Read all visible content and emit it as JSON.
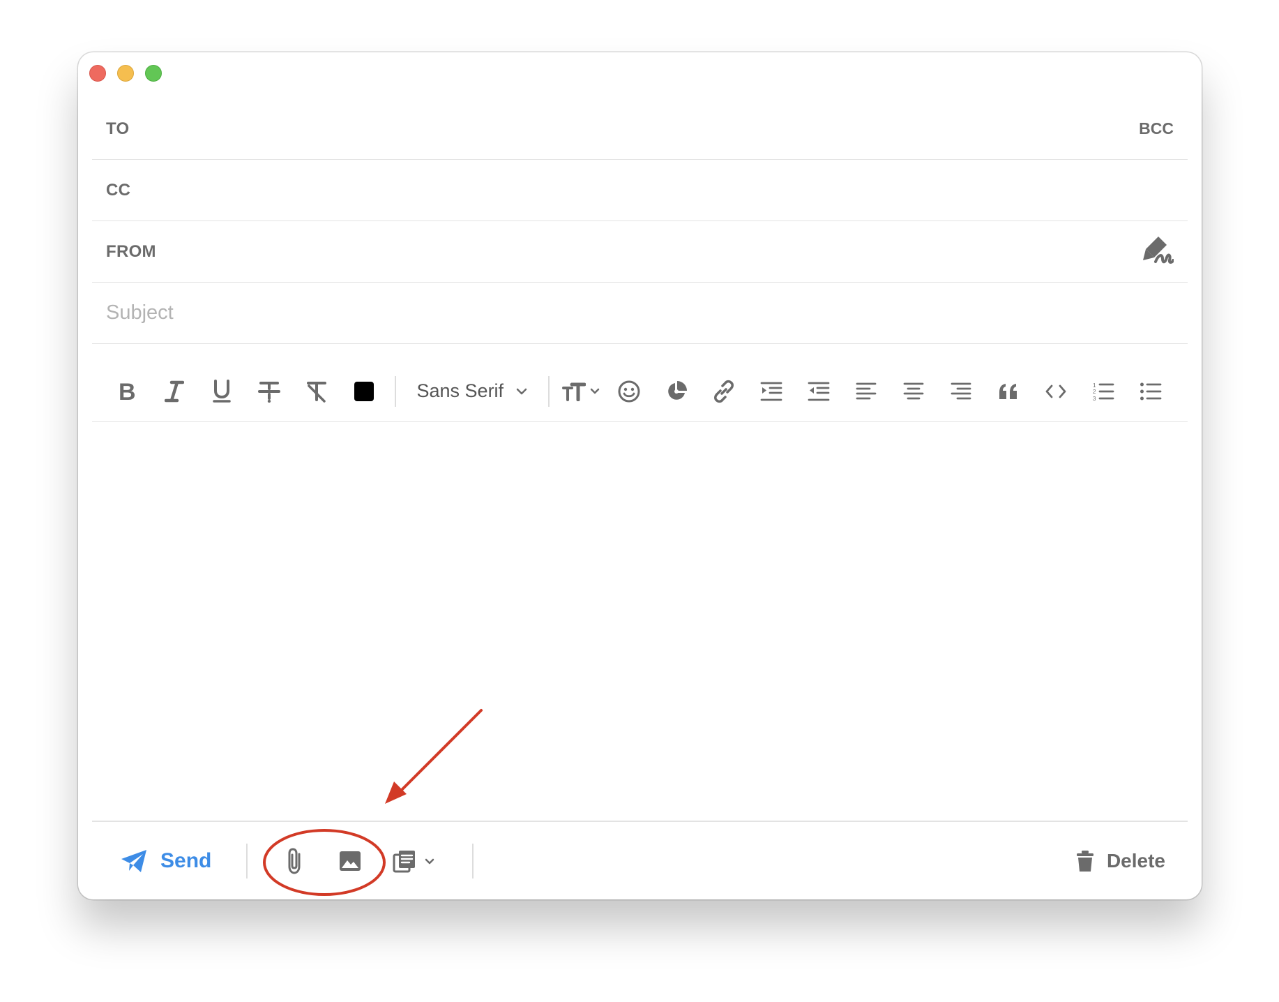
{
  "window": {
    "controls": [
      "close",
      "minimize",
      "zoom"
    ]
  },
  "fields": {
    "to_label": "TO",
    "bcc_label": "BCC",
    "cc_label": "CC",
    "from_label": "FROM",
    "subject_placeholder": "Subject",
    "subject_value": ""
  },
  "toolbar": {
    "buttons": [
      "bold-icon",
      "italic-icon",
      "underline-icon",
      "strikethrough-icon",
      "clear-format-icon",
      "text-color-swatch"
    ],
    "text_color": "#000000",
    "font_family_selected": "Sans Serif",
    "buttons_after_font": [
      "text-size-icon",
      "emoji-icon",
      "pie-chart-icon",
      "link-icon",
      "indent-icon",
      "outdent-icon",
      "align-left-icon",
      "align-center-icon",
      "align-right-icon",
      "quote-icon",
      "code-icon",
      "ordered-list-icon",
      "bullet-list-icon"
    ]
  },
  "bottom_bar": {
    "send_label": "Send",
    "delete_label": "Delete",
    "icons": [
      "paperclip-icon",
      "image-icon",
      "template-icon"
    ]
  },
  "colors": {
    "accent_blue": "#3d8ce6",
    "icon_gray": "#6b6b6b",
    "annotation_red": "#d23a26"
  }
}
